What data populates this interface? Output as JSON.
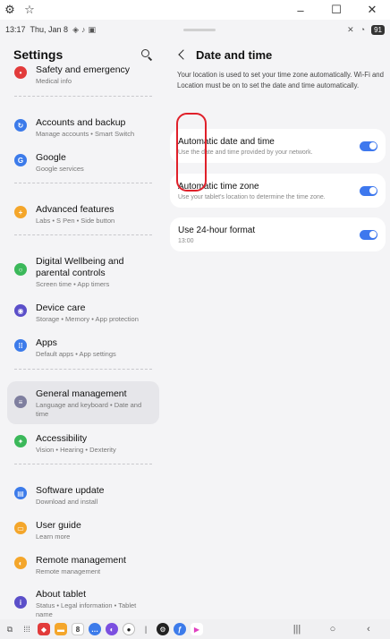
{
  "window": {
    "settings_glyph": "⚙",
    "pin_glyph": "☆",
    "minimize": "–",
    "maximize": "☐",
    "close": "✕"
  },
  "status_bar": {
    "time": "13:17",
    "date": "Thu, Jan 8",
    "battery": "91"
  },
  "left_pane": {
    "title": "Settings",
    "items": [
      {
        "title": "Safety and emergency",
        "sub": "Medical info",
        "color": "#e23b3b"
      },
      {
        "title": "Accounts and backup",
        "sub": "Manage accounts • Smart Switch",
        "color": "#3c7bea"
      },
      {
        "title": "Google",
        "sub": "Google services",
        "color": "#3c7bea",
        "glyph": "G"
      },
      {
        "title": "Advanced features",
        "sub": "Labs • S Pen • Side button",
        "color": "#f4a62b"
      },
      {
        "title": "Digital Wellbeing and parental controls",
        "sub": "Screen time • App timers",
        "color": "#3bb85a"
      },
      {
        "title": "Device care",
        "sub": "Storage • Memory • App protection",
        "color": "#5b4fc9"
      },
      {
        "title": "Apps",
        "sub": "Default apps • App settings",
        "color": "#3c7bea"
      },
      {
        "title": "General management",
        "sub": "Language and keyboard • Date and time",
        "color": "#7f7f9f"
      },
      {
        "title": "Accessibility",
        "sub": "Vision • Hearing • Dexterity",
        "color": "#3bb85a"
      },
      {
        "title": "Software update",
        "sub": "Download and install",
        "color": "#3c7bea"
      },
      {
        "title": "User guide",
        "sub": "Learn more",
        "color": "#f4a62b"
      },
      {
        "title": "Remote management",
        "sub": "Remote management",
        "color": "#f4a62b"
      },
      {
        "title": "About tablet",
        "sub": "Status • Legal information • Tablet name",
        "color": "#5b4fc9"
      }
    ]
  },
  "right_pane": {
    "title": "Date and time",
    "info": "Your location is used to set your time zone automatically. Wi-Fi and Location must be on to set the date and time automatically.",
    "settings": [
      {
        "title": "Automatic date and time",
        "sub": "Use the date and time provided by your network.",
        "enabled": true
      },
      {
        "title": "Automatic time zone",
        "sub": "Use your tablet's location to determine the time zone.",
        "enabled": true
      },
      {
        "title": "Use 24-hour format",
        "sub": "13:00",
        "enabled": true
      }
    ],
    "accent": "#3e78ee",
    "highlight_color": "#e0202a"
  },
  "taskbar": {
    "calendar_day": "8"
  }
}
